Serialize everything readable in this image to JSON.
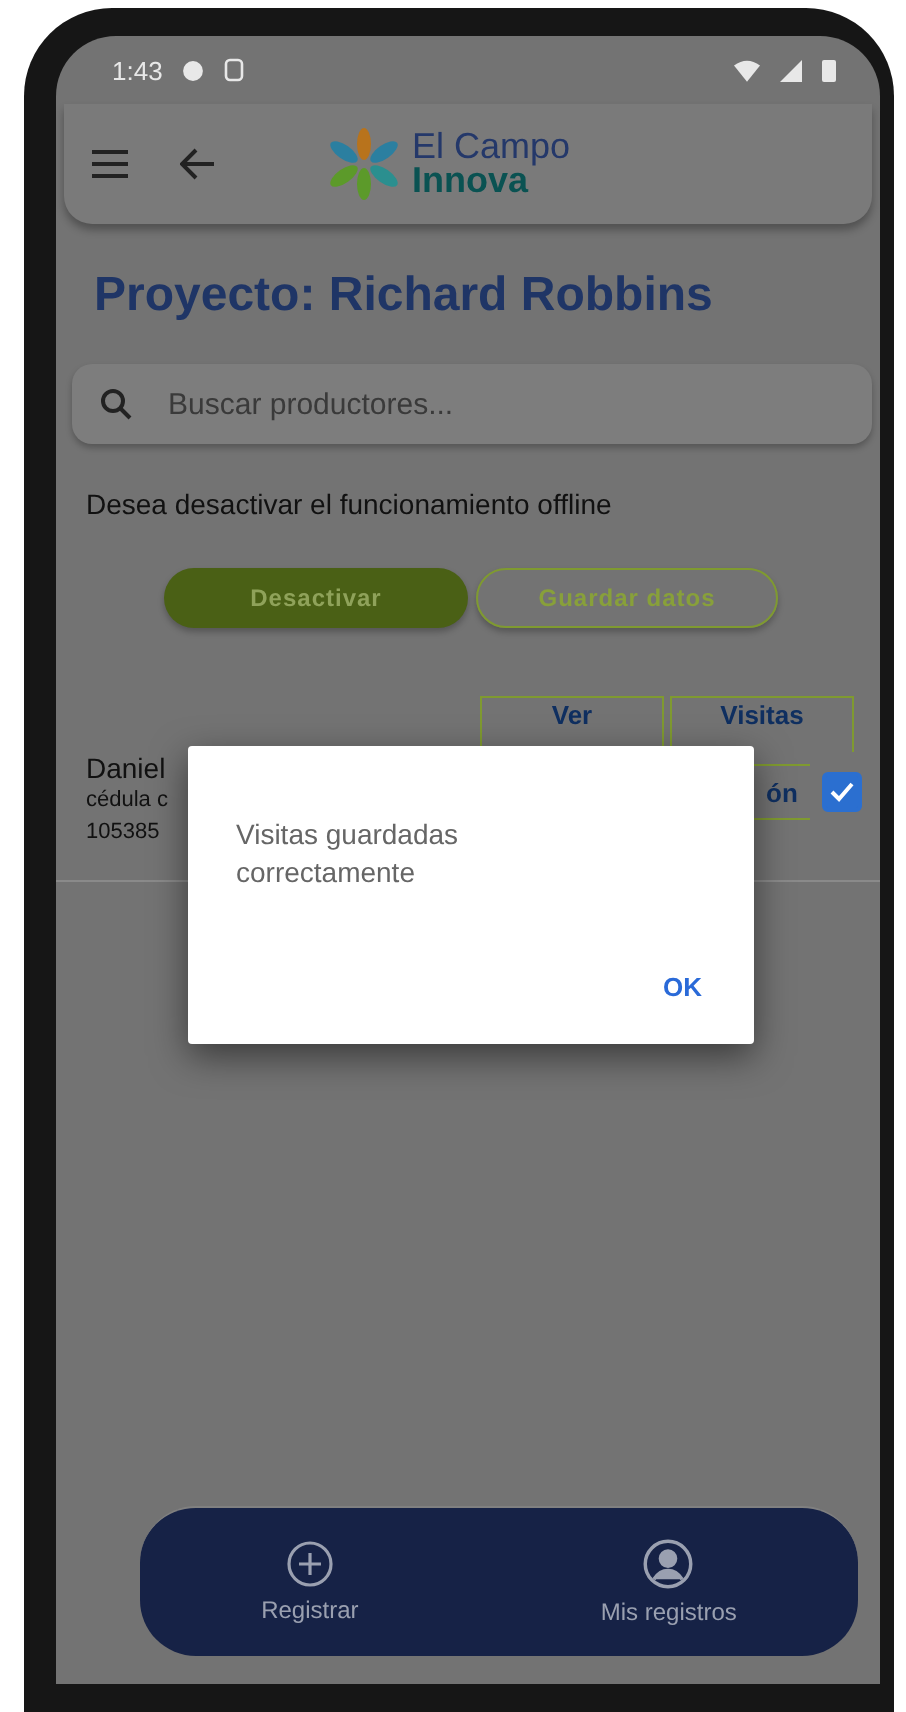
{
  "status_bar": {
    "time": "1:43"
  },
  "header": {
    "logo_line1": "El Campo",
    "logo_line2": "Innova"
  },
  "title": "Proyecto: Richard Robbins",
  "search": {
    "placeholder": "Buscar productores..."
  },
  "offline_prompt": "Desea desactivar el funcionamiento offline",
  "actions": [
    {
      "label": "Desactivar",
      "kind": "filled"
    },
    {
      "label": "Guardar datos",
      "kind": "outlined"
    }
  ],
  "producer": {
    "name": "Daniel",
    "id_label": "cédula c",
    "id_number": "105385",
    "buttons": [
      "Ver",
      "Visitas"
    ],
    "partial_button": "ón",
    "checked": true
  },
  "dialog": {
    "message": "Visitas guardadas correctamente",
    "button": "OK"
  },
  "bottom_nav": [
    {
      "label": "Registrar"
    },
    {
      "label": "Mis registros"
    }
  ]
}
